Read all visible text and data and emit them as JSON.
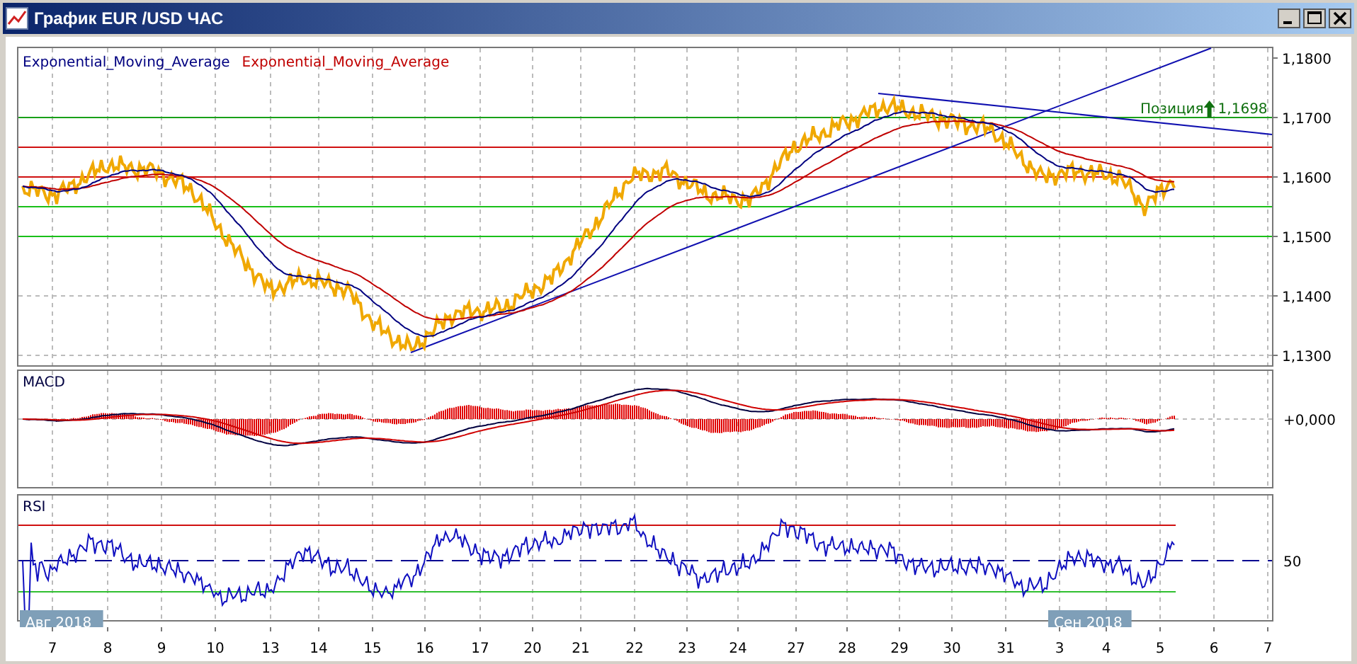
{
  "window": {
    "title": "График EUR /USD  ЧАС"
  },
  "main_pane": {
    "legend": [
      {
        "text": "Exponential_Moving_Average",
        "color": "#000080"
      },
      {
        "text": "Exponential_Moving_Average",
        "color": "#c00000"
      }
    ],
    "position_marker": {
      "label": "Позиция",
      "price": "1,1698"
    },
    "price_axis": [
      "1,1800",
      "1,1700",
      "1,1600",
      "1,1500",
      "1,1400",
      "1,1300"
    ]
  },
  "macd_pane": {
    "title": "MACD",
    "axis": [
      "+0,000"
    ]
  },
  "rsi_pane": {
    "title": "RSI",
    "axis": [
      "50"
    ],
    "month_labels": [
      "Авг 2018",
      "Сен 2018"
    ]
  },
  "date_axis": [
    "7",
    "8",
    "9",
    "10",
    "13",
    "14",
    "15",
    "16",
    "17",
    "20",
    "21",
    "22",
    "23",
    "24",
    "27",
    "28",
    "29",
    "30",
    "31",
    "3",
    "4",
    "5",
    "6",
    "7"
  ]
}
